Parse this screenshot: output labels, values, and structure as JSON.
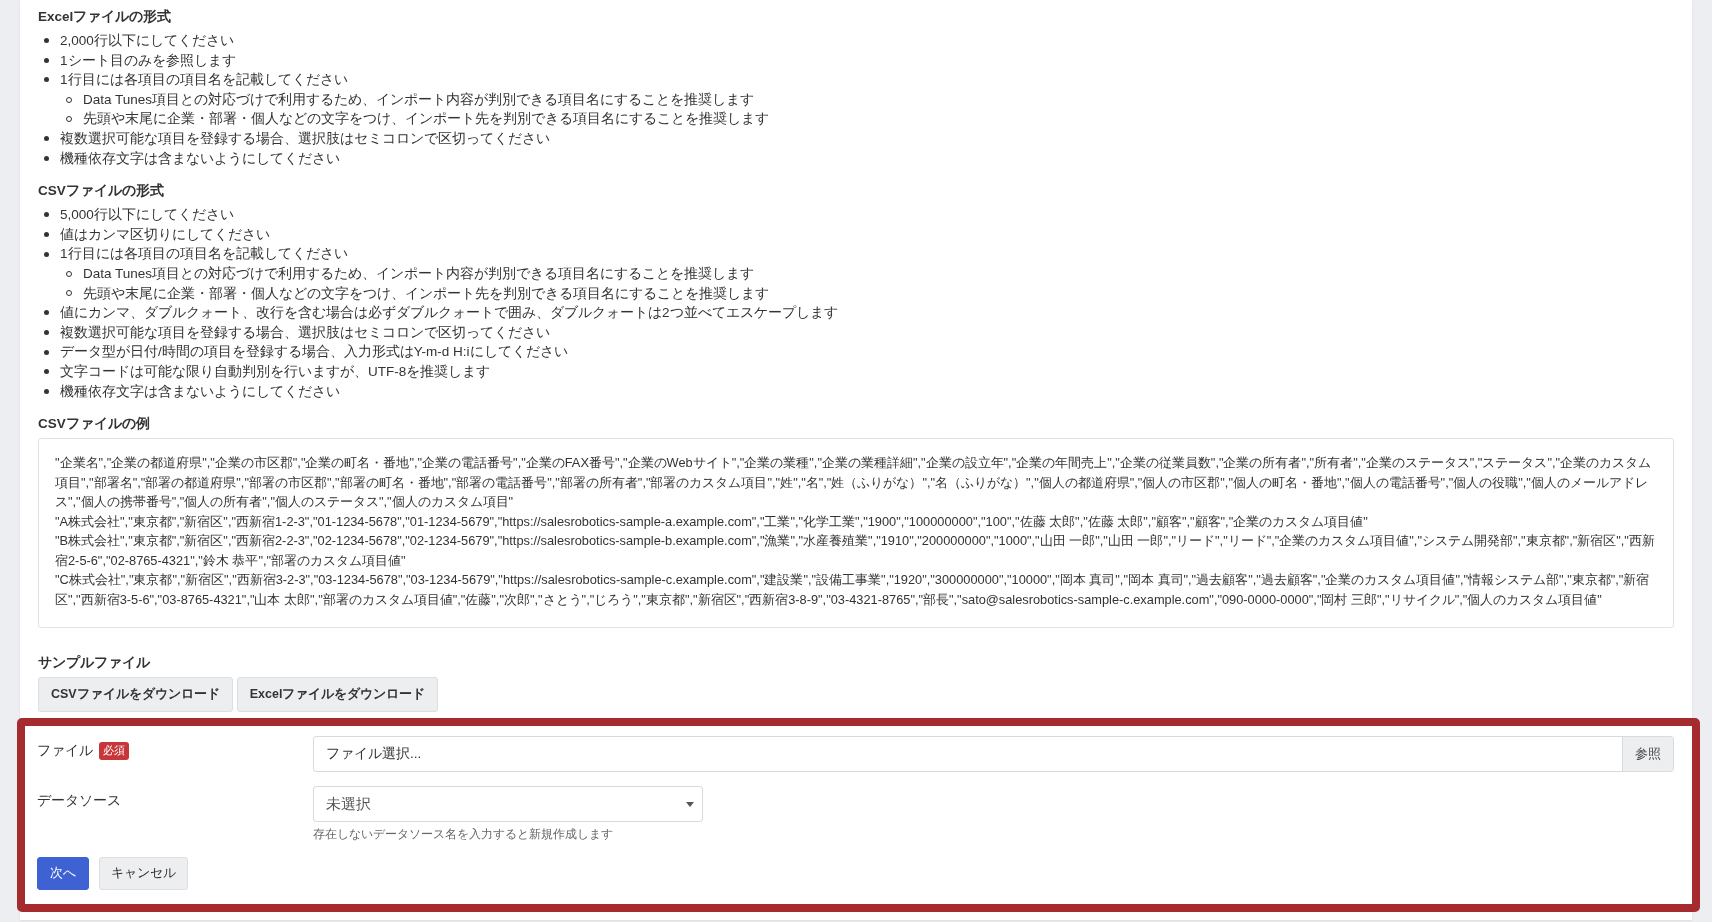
{
  "sections": [
    {
      "title": "Excelファイルの形式",
      "items": [
        {
          "text": "2,000行以下にしてください"
        },
        {
          "text": "1シート目のみを参照します"
        },
        {
          "text": "1行目には各項目の項目名を記載してください",
          "children": [
            {
              "text": "Data Tunes項目との対応づけで利用するため、インポート内容が判別できる項目名にすることを推奨します"
            },
            {
              "text": "先頭や末尾に企業・部署・個人などの文字をつけ、インポート先を判別できる項目名にすることを推奨します"
            }
          ]
        },
        {
          "text": "複数選択可能な項目を登録する場合、選択肢はセミコロンで区切ってください"
        },
        {
          "text": "機種依存文字は含まないようにしてください"
        }
      ]
    },
    {
      "title": "CSVファイルの形式",
      "items": [
        {
          "text": "5,000行以下にしてください"
        },
        {
          "text": "値はカンマ区切りにしてください"
        },
        {
          "text": "1行目には各項目の項目名を記載してください",
          "children": [
            {
              "text": "Data Tunes項目との対応づけで利用するため、インポート内容が判別できる項目名にすることを推奨します"
            },
            {
              "text": "先頭や末尾に企業・部署・個人などの文字をつけ、インポート先を判別できる項目名にすることを推奨します"
            }
          ]
        },
        {
          "text": "値にカンマ、ダブルクォート、改行を含む場合は必ずダブルクォートで囲み、ダブルクォートは2つ並べてエスケープします"
        },
        {
          "text": "複数選択可能な項目を登録する場合、選択肢はセミコロンで区切ってください"
        },
        {
          "text": "データ型が日付/時間の項目を登録する場合、入力形式はY-m-d H:iにしてください"
        },
        {
          "text": "文字コードは可能な限り自動判別を行いますが、UTF-8を推奨します"
        },
        {
          "text": "機種依存文字は含まないようにしてください"
        }
      ]
    }
  ],
  "csv_example": {
    "title": "CSVファイルの例",
    "lines": [
      "\"企業名\",\"企業の都道府県\",\"企業の市区郡\",\"企業の町名・番地\",\"企業の電話番号\",\"企業のFAX番号\",\"企業のWebサイト\",\"企業の業種\",\"企業の業種詳細\",\"企業の設立年\",\"企業の年間売上\",\"企業の従業員数\",\"企業の所有者\",\"所有者\",\"企業のステータス\",\"ステータス\",\"企業のカスタム項目\",\"部署名\",\"部署の都道府県\",\"部署の市区郡\",\"部署の町名・番地\",\"部署の電話番号\",\"部署の所有者\",\"部署のカスタム項目\",\"姓\",\"名\",\"姓（ふりがな）\",\"名（ふりがな）\",\"個人の都道府県\",\"個人の市区郡\",\"個人の町名・番地\",\"個人の電話番号\",\"個人の役職\",\"個人のメールアドレス\",\"個人の携帯番号\",\"個人の所有者\",\"個人のステータス\",\"個人のカスタム項目\"",
      "\"A株式会社\",\"東京都\",\"新宿区\",\"西新宿1-2-3\",\"01-1234-5678\",\"01-1234-5679\",\"https://salesrobotics-sample-a.example.com\",\"工業\",\"化学工業\",\"1900\",\"100000000\",\"100\",\"佐藤 太郎\",\"佐藤 太郎\",\"顧客\",\"顧客\",\"企業のカスタム項目値\"",
      "\"B株式会社\",\"東京都\",\"新宿区\",\"西新宿2-2-3\",\"02-1234-5678\",\"02-1234-5679\",\"https://salesrobotics-sample-b.example.com\",\"漁業\",\"水産養殖業\",\"1910\",\"200000000\",\"1000\",\"山田 一郎\",\"山田 一郎\",\"リード\",\"リード\",\"企業のカスタム項目値\",\"システム開発部\",\"東京都\",\"新宿区\",\"西新宿2-5-6\",\"02-8765-4321\",\"鈴木 恭平\",\"部署のカスタム項目値\"",
      "\"C株式会社\",\"東京都\",\"新宿区\",\"西新宿3-2-3\",\"03-1234-5678\",\"03-1234-5679\",\"https://salesrobotics-sample-c.example.com\",\"建設業\",\"設備工事業\",\"1920\",\"300000000\",\"10000\",\"岡本 真司\",\"岡本 真司\",\"過去顧客\",\"過去顧客\",\"企業のカスタム項目値\",\"情報システム部\",\"東京都\",\"新宿区\",\"西新宿3-5-6\",\"03-8765-4321\",\"山本 太郎\",\"部署のカスタム項目値\",\"佐藤\",\"次郎\",\"さとう\",\"じろう\",\"東京都\",\"新宿区\",\"西新宿3-8-9\",\"03-4321-8765\",\"部長\",\"sato@salesrobotics-sample-c.example.com\",\"090-0000-0000\",\"岡村 三郎\",\"リサイクル\",\"個人のカスタム項目値\""
    ]
  },
  "sample_files": {
    "title": "サンプルファイル",
    "buttons": [
      "CSVファイルをダウンロード",
      "Excelファイルをダウンロード"
    ]
  },
  "form": {
    "fields": [
      {
        "kind": "file",
        "label": "ファイル",
        "required": "必須",
        "placeholder": "ファイル選択...",
        "button": "参照"
      },
      {
        "kind": "select",
        "label": "データソース",
        "value": "未選択",
        "help": "存在しないデータソース名を入力すると新規作成します"
      }
    ],
    "buttons": [
      {
        "kind": "primary",
        "label": "次へ"
      },
      {
        "kind": "secondary",
        "label": "キャンセル"
      }
    ]
  }
}
